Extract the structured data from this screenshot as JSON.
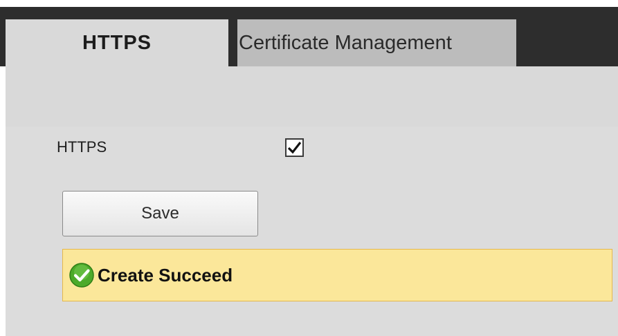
{
  "tabs": [
    {
      "label": "HTTPS",
      "active": true
    },
    {
      "label": "Certificate Management",
      "active": false
    }
  ],
  "form": {
    "https_label": "HTTPS",
    "https_enabled": true
  },
  "actions": {
    "save_label": "Save"
  },
  "notice": {
    "text": "Create Succeed",
    "icon": "success-check-icon"
  },
  "colors": {
    "tabbar_bg": "#2d2d2d",
    "panel_bg": "#d9d9d9",
    "notice_bg": "#fbe79a",
    "notice_border": "#e6b84a",
    "success_green": "#4caa2a"
  }
}
